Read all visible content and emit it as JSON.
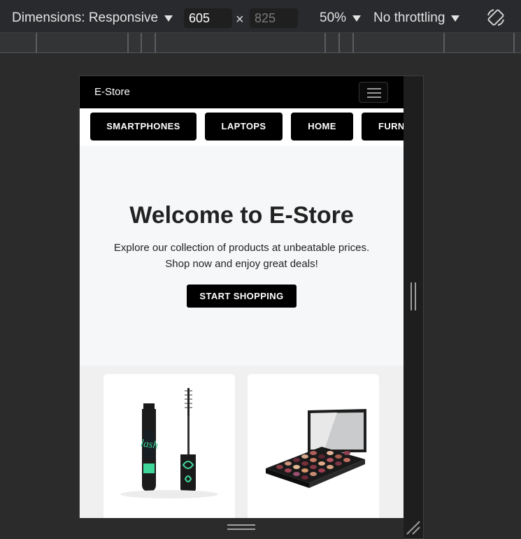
{
  "devtools": {
    "dimensions_label": "Dimensions: Responsive",
    "width_value": "605",
    "height_placeholder": "825",
    "times_symbol": "×",
    "zoom": "50%",
    "throttling": "No throttling",
    "rotate_icon": "rotate-device-icon"
  },
  "site": {
    "brand": "E-Store",
    "menu_icon": "hamburger-menu-icon",
    "categories": [
      "SMARTPHONES",
      "LAPTOPS",
      "HOME",
      "FURN"
    ],
    "hero": {
      "title": "Welcome to E-Store",
      "line1": "Explore our collection of products at unbeatable prices.",
      "line2": "Shop now and enjoy great deals!",
      "cta": "START SHOPPING"
    },
    "products": [
      {
        "image": "mascara-product-image"
      },
      {
        "image": "eyeshadow-palette-product-image"
      }
    ]
  },
  "colors": {
    "navbar": "#000000",
    "hero_bg": "#f6f7f9",
    "devtools_bg": "#292a2d"
  }
}
